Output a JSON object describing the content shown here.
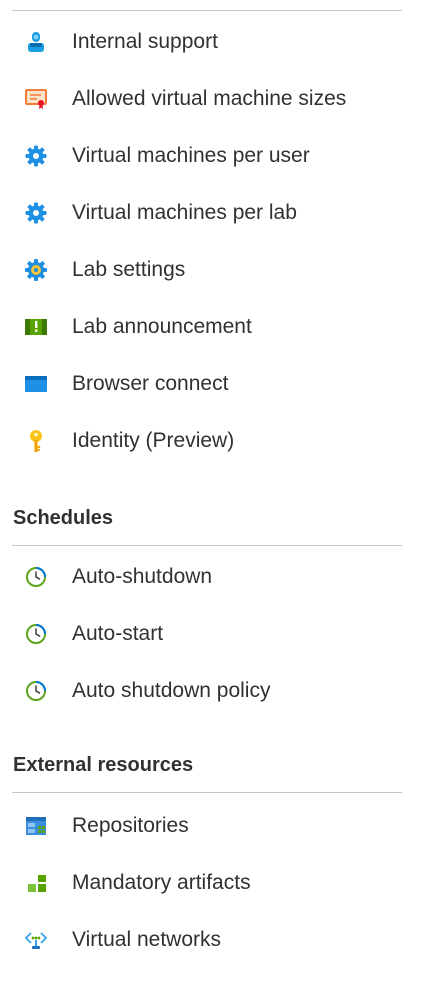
{
  "colors": {
    "divider": "#c8c6c4",
    "text": "#323130",
    "clock_green": "#5ea51b",
    "clock_blue": "#0078d4",
    "gear_blue": "#1e90e6"
  },
  "groups": [
    {
      "items": [
        {
          "label": "Internal support",
          "icon": "support-person-icon"
        },
        {
          "label": "Allowed virtual machine sizes",
          "icon": "vm-sizes-certificate-icon"
        },
        {
          "label": "Virtual machines per user",
          "icon": "gear-icon"
        },
        {
          "label": "Virtual machines per lab",
          "icon": "gear-icon"
        },
        {
          "label": "Lab settings",
          "icon": "lab-settings-gear-icon"
        },
        {
          "label": "Lab announcement",
          "icon": "announcement-icon"
        },
        {
          "label": "Browser connect",
          "icon": "browser-window-icon"
        },
        {
          "label": "Identity (Preview)",
          "icon": "key-icon"
        }
      ]
    },
    {
      "title": "Schedules",
      "items": [
        {
          "label": "Auto-shutdown",
          "icon": "clock-icon"
        },
        {
          "label": "Auto-start",
          "icon": "clock-icon"
        },
        {
          "label": "Auto shutdown policy",
          "icon": "clock-icon"
        }
      ]
    },
    {
      "title": "External resources",
      "items": [
        {
          "label": "Repositories",
          "icon": "repository-icon"
        },
        {
          "label": "Mandatory artifacts",
          "icon": "artifacts-blocks-icon"
        },
        {
          "label": "Virtual networks",
          "icon": "virtual-network-icon"
        }
      ]
    }
  ]
}
